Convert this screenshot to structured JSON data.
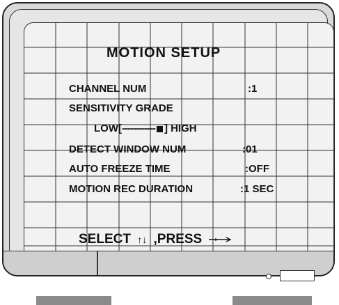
{
  "screen": {
    "title": "MOTION SETUP",
    "rows": [
      {
        "label": "CHANNEL NUM",
        "value": ":1"
      },
      {
        "label": "SENSITIVITY GRADE"
      },
      {
        "slider_left": "LOW[",
        "slider_track": "------------",
        "slider_right": "] HIGH",
        "level_fraction": 0.8
      },
      {
        "label": "DETECT WINDOW NUM",
        "value": ":01"
      },
      {
        "label": "AUTO FREEZE TIME",
        "value": ":OFF"
      },
      {
        "label": "MOTION REC DURATION",
        "value": ":1 SEC"
      }
    ],
    "footer": {
      "select_label": "SELECT",
      "arrows": "↑↓",
      "press_label": ",PRESS",
      "enter_icon": "enter-icon"
    }
  }
}
